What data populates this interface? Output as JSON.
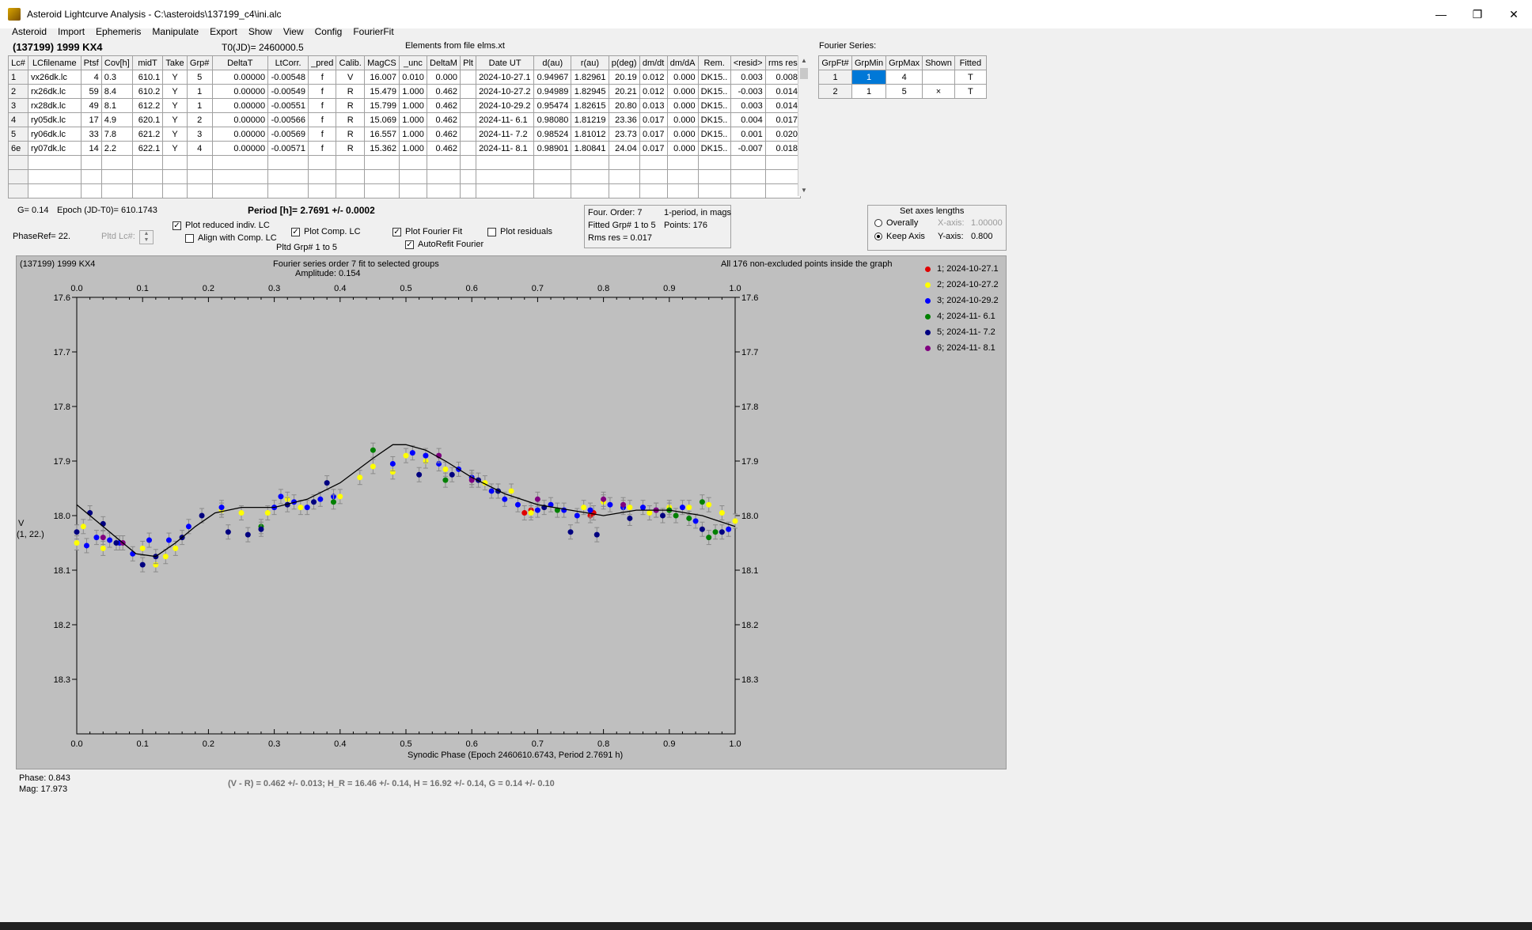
{
  "window": {
    "title": "Asteroid Lightcurve Analysis - C:\\asteroids\\137199_c4\\ini.alc",
    "btn_min": "—",
    "btn_max": "❐",
    "btn_close": "✕"
  },
  "menu": [
    "Asteroid",
    "Import",
    "Ephemeris",
    "Manipulate",
    "Export",
    "Show",
    "View",
    "Config",
    "FourierFit"
  ],
  "header": {
    "object": "(137199) 1999 KX4",
    "t0": "T0(JD)= 2460000.5",
    "elements": "Elements from file elms.xt",
    "fourier_series": "Fourier Series:"
  },
  "lc_table": {
    "columns": [
      "Lc#",
      "LCfilename",
      "Ptsf",
      "Cov[h]",
      "midT",
      "Take",
      "Grp#",
      "DeltaT",
      "LtCorr.",
      "_pred",
      "Calib.",
      "MagCS",
      "_unc",
      "DeltaM",
      "Plt",
      "Date UT",
      "d(au)",
      "r(au)",
      "p(deg)",
      "dm/dt",
      "dm/dA",
      "Rem.",
      "<resid>",
      "rms res"
    ],
    "rows": [
      [
        "1",
        "vx26dk.lc",
        "4",
        "0.3",
        "610.1",
        "Y",
        "5",
        "0.00000",
        "-0.00548",
        "f",
        "V",
        "16.007",
        "0.010",
        "0.000",
        "",
        "2024-10-27.1",
        "0.94967",
        "1.82961",
        "20.19",
        "0.012",
        "0.000",
        "DK15..",
        "0.003",
        "0.008"
      ],
      [
        "2",
        "rx26dk.lc",
        "59",
        "8.4",
        "610.2",
        "Y",
        "1",
        "0.00000",
        "-0.00549",
        "f",
        "R",
        "15.479",
        "1.000",
        "0.462",
        "",
        "2024-10-27.2",
        "0.94989",
        "1.82945",
        "20.21",
        "0.012",
        "0.000",
        "DK15..",
        "-0.003",
        "0.014"
      ],
      [
        "3",
        "rx28dk.lc",
        "49",
        "8.1",
        "612.2",
        "Y",
        "1",
        "0.00000",
        "-0.00551",
        "f",
        "R",
        "15.799",
        "1.000",
        "0.462",
        "",
        "2024-10-29.2",
        "0.95474",
        "1.82615",
        "20.80",
        "0.013",
        "0.000",
        "DK15..",
        "0.003",
        "0.014"
      ],
      [
        "4",
        "ry05dk.lc",
        "17",
        "4.9",
        "620.1",
        "Y",
        "2",
        "0.00000",
        "-0.00566",
        "f",
        "R",
        "15.069",
        "1.000",
        "0.462",
        "",
        "2024-11- 6.1",
        "0.98080",
        "1.81219",
        "23.36",
        "0.017",
        "0.000",
        "DK15..",
        "0.004",
        "0.017"
      ],
      [
        "5",
        "ry06dk.lc",
        "33",
        "7.8",
        "621.2",
        "Y",
        "3",
        "0.00000",
        "-0.00569",
        "f",
        "R",
        "16.557",
        "1.000",
        "0.462",
        "",
        "2024-11- 7.2",
        "0.98524",
        "1.81012",
        "23.73",
        "0.017",
        "0.000",
        "DK15..",
        "0.001",
        "0.020"
      ],
      [
        "6e",
        "ry07dk.lc",
        "14",
        "2.2",
        "622.1",
        "Y",
        "4",
        "0.00000",
        "-0.00571",
        "f",
        "R",
        "15.362",
        "1.000",
        "0.462",
        "",
        "2024-11- 8.1",
        "0.98901",
        "1.80841",
        "24.04",
        "0.017",
        "0.000",
        "DK15..",
        "-0.007",
        "0.018"
      ]
    ]
  },
  "fs_table": {
    "columns": [
      "GrpFt#",
      "GrpMin",
      "GrpMax",
      "Shown",
      "Fitted"
    ],
    "rows": [
      [
        "1",
        "1",
        "4",
        "",
        "T"
      ],
      [
        "2",
        "1",
        "5",
        "×",
        "T"
      ]
    ]
  },
  "controls": {
    "g": "G= 0.14",
    "epoch": "Epoch (JD-T0)= 610.1743",
    "period": "Period [h]= 2.7691 +/- 0.0002",
    "phaseref": "PhaseRef= 22.",
    "pltd_lc": "Pltd Lc#:",
    "plot_reduced": "Plot reduced indiv. LC",
    "align_comp": "Align with Comp. LC",
    "plot_comp": "Plot Comp. LC",
    "pltd_grp": "Pltd Grp#  1   to   5",
    "plot_fourier": "Plot Fourier Fit",
    "autorefit": "AutoRefit Fourier",
    "plot_residuals": "Plot residuals",
    "four_order": "Four. Order:  7",
    "one_period": "1-period, in mags",
    "fitted_grp": "Fitted Grp# 1 to 5",
    "points": "Points: 176",
    "rms": "Rms res      = 0.017",
    "axes_title": "Set axes lengths",
    "overally": "Overally",
    "keep_axis": "Keep Axis",
    "x_axis_label": "X-axis:",
    "x_axis_val": "1.00000",
    "y_axis_label": "Y-axis:",
    "y_axis_val": "0.800"
  },
  "plot": {
    "object": "(137199) 1999 KX4",
    "fit_title": "Fourier series order 7 fit to selected groups",
    "amplitude": "Amplitude: 0.154",
    "inside": "All 176 non-excluded points inside the graph",
    "ylabel": "V",
    "ylabel2": "(1, 22.)",
    "xlabel": "Synodic Phase (Epoch 2460610.6743, Period 2.7691 h)",
    "legend": [
      {
        "label": "1; 2024-10-27.1",
        "color": "#e00000"
      },
      {
        "label": "2; 2024-10-27.2",
        "color": "#ffff00"
      },
      {
        "label": "3; 2024-10-29.2",
        "color": "#0000ff"
      },
      {
        "label": "4; 2024-11- 6.1",
        "color": "#008000"
      },
      {
        "label": "5; 2024-11- 7.2",
        "color": "#000080"
      },
      {
        "label": "6; 2024-11- 8.1",
        "color": "#800080"
      }
    ]
  },
  "footer": {
    "phase": "Phase:  0.843",
    "mag": "Mag:    17.973",
    "color_index": "(V - R) = 0.462 +/- 0.013; H_R = 16.46 +/- 0.14, H = 16.92 +/- 0.14, G = 0.14 +/- 0.10"
  },
  "chart_data": {
    "type": "scatter",
    "xlim": [
      0.0,
      1.0
    ],
    "ylim": [
      17.6,
      18.4
    ],
    "y_inverted": true,
    "xticks": [
      "0.0",
      "0.1",
      "0.2",
      "0.3",
      "0.4",
      "0.5",
      "0.6",
      "0.7",
      "0.8",
      "0.9",
      "1.0"
    ],
    "yticks": [
      "17.6",
      "17.7",
      "17.8",
      "17.9",
      "18.0",
      "18.1",
      "18.2",
      "18.3"
    ],
    "fit_curve": {
      "x": [
        0.0,
        0.03,
        0.06,
        0.09,
        0.12,
        0.15,
        0.18,
        0.21,
        0.25,
        0.3,
        0.35,
        0.4,
        0.45,
        0.48,
        0.5,
        0.53,
        0.56,
        0.6,
        0.65,
        0.7,
        0.75,
        0.8,
        0.85,
        0.9,
        0.95,
        1.0
      ],
      "y": [
        17.98,
        18.01,
        18.04,
        18.07,
        18.075,
        18.05,
        18.02,
        17.995,
        17.985,
        17.985,
        17.97,
        17.94,
        17.895,
        17.87,
        17.87,
        17.88,
        17.9,
        17.93,
        17.96,
        17.98,
        17.99,
        18.0,
        17.99,
        17.99,
        18.0,
        18.02
      ]
    },
    "series": [
      {
        "name": "1; 2024-10-27.1",
        "color": "#e00000",
        "points": [
          [
            0.68,
            17.995
          ],
          [
            0.78,
            18.0
          ],
          [
            0.785,
            17.995
          ],
          [
            0.69,
            17.99
          ]
        ]
      },
      {
        "name": "2; 2024-10-27.2",
        "color": "#ffff00",
        "points": [
          [
            0.0,
            18.05
          ],
          [
            0.01,
            18.02
          ],
          [
            0.04,
            18.06
          ],
          [
            0.1,
            18.06
          ],
          [
            0.12,
            18.09
          ],
          [
            0.135,
            18.075
          ],
          [
            0.15,
            18.06
          ],
          [
            0.22,
            17.99
          ],
          [
            0.25,
            17.995
          ],
          [
            0.29,
            17.995
          ],
          [
            0.32,
            17.97
          ],
          [
            0.34,
            17.985
          ],
          [
            0.4,
            17.965
          ],
          [
            0.43,
            17.93
          ],
          [
            0.45,
            17.91
          ],
          [
            0.48,
            17.92
          ],
          [
            0.5,
            17.89
          ],
          [
            0.53,
            17.9
          ],
          [
            0.56,
            17.915
          ],
          [
            0.6,
            17.93
          ],
          [
            0.62,
            17.94
          ],
          [
            0.66,
            17.955
          ],
          [
            0.69,
            17.995
          ],
          [
            0.77,
            17.985
          ],
          [
            0.8,
            17.975
          ],
          [
            0.84,
            17.985
          ],
          [
            0.87,
            17.995
          ],
          [
            0.9,
            17.985
          ],
          [
            0.93,
            17.985
          ],
          [
            0.96,
            17.98
          ],
          [
            0.98,
            17.995
          ],
          [
            1.0,
            18.01
          ]
        ]
      },
      {
        "name": "3; 2024-10-29.2",
        "color": "#0000ff",
        "points": [
          [
            0.015,
            18.055
          ],
          [
            0.03,
            18.04
          ],
          [
            0.05,
            18.045
          ],
          [
            0.065,
            18.05
          ],
          [
            0.085,
            18.07
          ],
          [
            0.11,
            18.045
          ],
          [
            0.14,
            18.045
          ],
          [
            0.17,
            18.02
          ],
          [
            0.22,
            17.985
          ],
          [
            0.3,
            17.985
          ],
          [
            0.31,
            17.965
          ],
          [
            0.33,
            17.975
          ],
          [
            0.35,
            17.985
          ],
          [
            0.37,
            17.97
          ],
          [
            0.39,
            17.965
          ],
          [
            0.48,
            17.905
          ],
          [
            0.51,
            17.885
          ],
          [
            0.53,
            17.89
          ],
          [
            0.55,
            17.905
          ],
          [
            0.58,
            17.915
          ],
          [
            0.6,
            17.93
          ],
          [
            0.63,
            17.955
          ],
          [
            0.65,
            17.97
          ],
          [
            0.67,
            17.98
          ],
          [
            0.7,
            17.99
          ],
          [
            0.72,
            17.98
          ],
          [
            0.74,
            17.99
          ],
          [
            0.76,
            18.0
          ],
          [
            0.78,
            17.99
          ],
          [
            0.81,
            17.98
          ],
          [
            0.83,
            17.985
          ],
          [
            0.86,
            17.985
          ],
          [
            0.88,
            17.99
          ],
          [
            0.92,
            17.985
          ],
          [
            0.94,
            18.01
          ],
          [
            0.99,
            18.025
          ]
        ]
      },
      {
        "name": "4; 2024-11- 6.1",
        "color": "#008000",
        "points": [
          [
            0.28,
            18.02
          ],
          [
            0.39,
            17.975
          ],
          [
            0.45,
            17.88
          ],
          [
            0.56,
            17.935
          ],
          [
            0.64,
            17.955
          ],
          [
            0.73,
            17.99
          ],
          [
            0.9,
            17.99
          ],
          [
            0.91,
            18.0
          ],
          [
            0.93,
            18.005
          ],
          [
            0.95,
            17.975
          ],
          [
            0.96,
            18.04
          ],
          [
            0.97,
            18.03
          ]
        ]
      },
      {
        "name": "5; 2024-11- 7.2",
        "color": "#000080",
        "points": [
          [
            0.0,
            18.03
          ],
          [
            0.02,
            17.995
          ],
          [
            0.04,
            18.015
          ],
          [
            0.06,
            18.05
          ],
          [
            0.1,
            18.09
          ],
          [
            0.12,
            18.075
          ],
          [
            0.16,
            18.04
          ],
          [
            0.19,
            18.0
          ],
          [
            0.23,
            18.03
          ],
          [
            0.26,
            18.035
          ],
          [
            0.28,
            18.025
          ],
          [
            0.32,
            17.98
          ],
          [
            0.36,
            17.975
          ],
          [
            0.38,
            17.94
          ],
          [
            0.52,
            17.925
          ],
          [
            0.57,
            17.925
          ],
          [
            0.61,
            17.935
          ],
          [
            0.64,
            17.955
          ],
          [
            0.71,
            17.985
          ],
          [
            0.75,
            18.03
          ],
          [
            0.79,
            18.035
          ],
          [
            0.84,
            18.005
          ],
          [
            0.89,
            18.0
          ],
          [
            0.95,
            18.025
          ],
          [
            0.98,
            18.03
          ]
        ]
      },
      {
        "name": "6; 2024-11- 8.1",
        "color": "#800080",
        "points": [
          [
            0.04,
            18.04
          ],
          [
            0.07,
            18.05
          ],
          [
            0.55,
            17.89
          ],
          [
            0.6,
            17.935
          ],
          [
            0.7,
            17.97
          ],
          [
            0.8,
            17.97
          ],
          [
            0.83,
            17.98
          ],
          [
            0.88,
            17.99
          ]
        ]
      }
    ]
  }
}
